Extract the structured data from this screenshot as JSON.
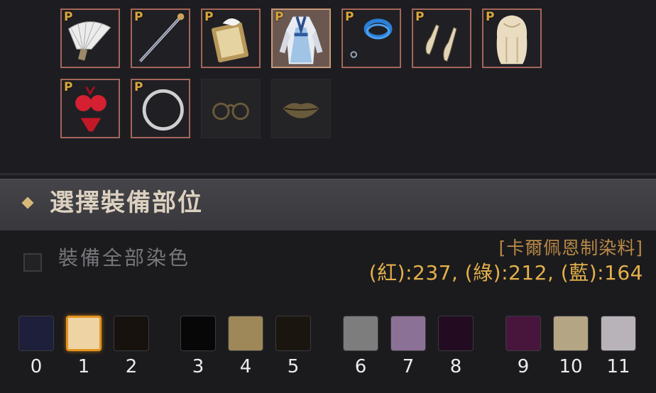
{
  "equipment": {
    "slots": [
      {
        "name": "fan",
        "badge": "P"
      },
      {
        "name": "staff",
        "badge": "P"
      },
      {
        "name": "scroll-book",
        "badge": "P"
      },
      {
        "name": "costume",
        "badge": "P",
        "selected": true
      },
      {
        "name": "bracelet",
        "badge": "P"
      },
      {
        "name": "shoes",
        "badge": "P"
      },
      {
        "name": "hair",
        "badge": "P"
      },
      {
        "name": "bikini",
        "badge": "P"
      },
      {
        "name": "ring",
        "badge": "P"
      },
      {
        "name": "glasses",
        "badge": ""
      },
      {
        "name": "lips",
        "badge": ""
      }
    ]
  },
  "section": {
    "title": "選擇裝備部位"
  },
  "dye_all": {
    "label": "裝備全部染色",
    "checked": false
  },
  "dye_info": {
    "name": "[卡爾佩恩制染料]",
    "rgb_text": "(紅):237, (綠):212, (藍):164"
  },
  "palette": [
    {
      "label": "0",
      "color": "#1e1f3a"
    },
    {
      "label": "1",
      "color": "#eed4a4",
      "selected": true
    },
    {
      "label": "2",
      "color": "#17120e"
    },
    {
      "label": "3",
      "color": "#070707"
    },
    {
      "label": "4",
      "color": "#9e8758"
    },
    {
      "label": "5",
      "color": "#1b1510"
    },
    {
      "label": "6",
      "color": "#7d7d7d"
    },
    {
      "label": "7",
      "color": "#8c7196"
    },
    {
      "label": "8",
      "color": "#230c22"
    },
    {
      "label": "9",
      "color": "#48163d"
    },
    {
      "label": "10",
      "color": "#b4a584"
    },
    {
      "label": "11",
      "color": "#b8b2b9"
    }
  ]
}
